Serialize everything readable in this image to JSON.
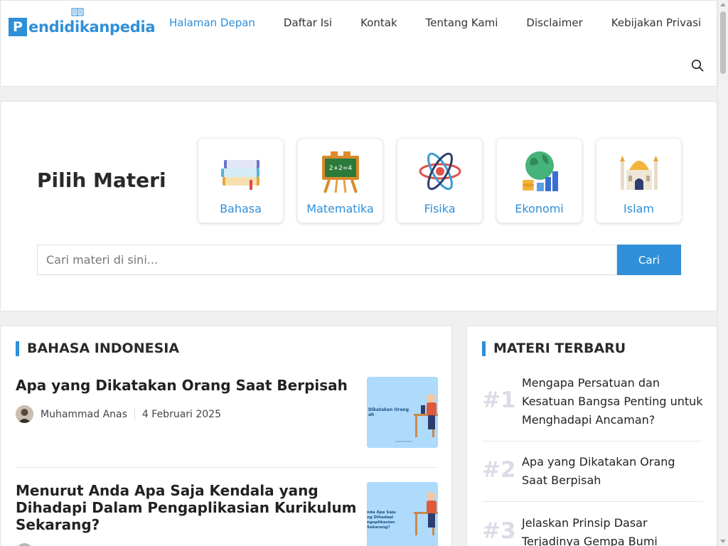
{
  "logo": {
    "letter": "P",
    "text": "endidikanpedia"
  },
  "nav": [
    "Halaman Depan",
    "Daftar Isi",
    "Kontak",
    "Tentang Kami",
    "Disclaimer",
    "Kebijakan Privasi"
  ],
  "materi": {
    "title": "Pilih Materi",
    "categories": [
      {
        "label": "Bahasa",
        "icon": "books-icon"
      },
      {
        "label": "Matematika",
        "icon": "chalkboard-icon"
      },
      {
        "label": "Fisika",
        "icon": "atom-icon"
      },
      {
        "label": "Ekonomi",
        "icon": "globe-coins-icon"
      },
      {
        "label": "Islam",
        "icon": "mosque-icon"
      }
    ],
    "search_placeholder": "Cari materi di sini...",
    "search_button": "Cari"
  },
  "left_section": {
    "title": "BAHASA INDONESIA",
    "posts": [
      {
        "title": "Apa yang Dikatakan Orang Saat Berpisah",
        "author": "Muhammad Anas",
        "date": "4 Februari 2025",
        "thumb_text": "Dikatakan Orang\nah"
      },
      {
        "title": "Menurut Anda Apa Saja Kendala yang Dihadapi Dalam Pengaplikasian Kurikulum Sekarang?",
        "thumb_text": "nda Apa Saja\nng Dihadapi\nngaplikasian\nSekarang?"
      }
    ]
  },
  "right_section": {
    "title": "MATERI TERBARU",
    "items": [
      {
        "rank": "#1",
        "text": "Mengapa Persatuan dan Kesatuan Bangsa Penting untuk Menghadapi Ancaman?"
      },
      {
        "rank": "#2",
        "text": "Apa yang Dikatakan Orang Saat Berpisah"
      },
      {
        "rank": "#3",
        "text": "Jelaskan Prinsip Dasar Terjadinya Gempa Bumi"
      }
    ]
  },
  "colors": {
    "accent": "#2f8fd8",
    "rank": "#dcdce8"
  }
}
